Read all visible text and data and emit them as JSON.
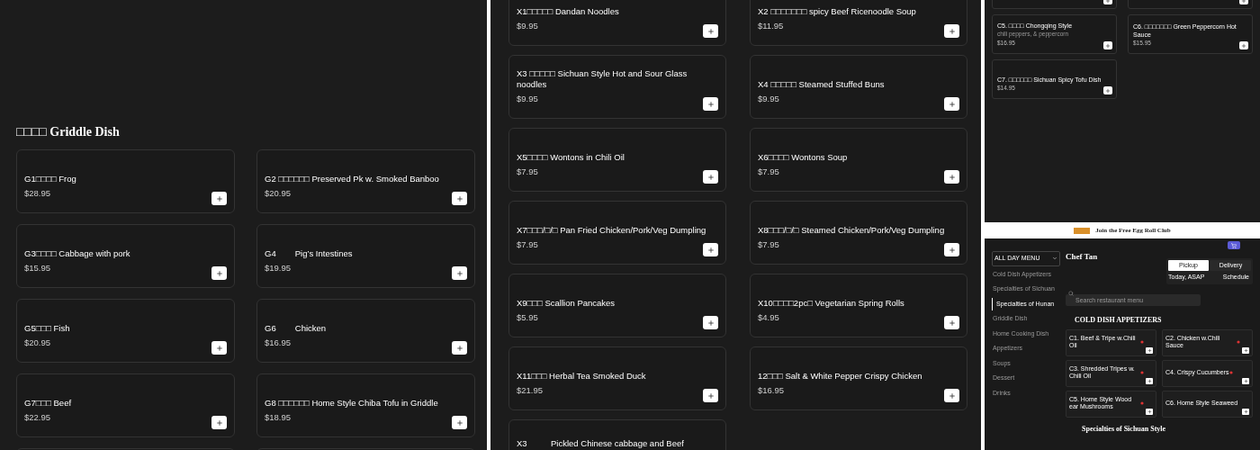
{
  "left_panel": {
    "section_title": "□□□□ Griddle Dish",
    "items": [
      {
        "name": "G1□□□□ Frog",
        "price": "$28.95"
      },
      {
        "name": "G2 □□□□□□ Preserved Pk w. Smoked Banboo",
        "price": "$20.95"
      },
      {
        "name": "G3□□□□ Cabbage with pork",
        "price": "$15.95"
      },
      {
        "name": "G4        Pig’s Intestines",
        "price": "$19.95"
      },
      {
        "name": "G5□□□ Fish",
        "price": "$20.95"
      },
      {
        "name": "G6        Chicken",
        "price": "$16.95"
      },
      {
        "name": "G7□□□ Beef",
        "price": "$22.95"
      },
      {
        "name": "G8 □□□□□□ Home Style Chiba Tofu in Griddle",
        "price": "$18.95"
      }
    ]
  },
  "middle_panel": {
    "items": [
      {
        "name": "X1□□□□□ Dandan Noodles",
        "price": "$9.95"
      },
      {
        "name": "X2 □□□□□□□ spicy Beef Ricenoodle Soup",
        "price": "$11.95"
      },
      {
        "name": "X3 □□□□□ Sichuan Style Hot and Sour Glass noodles",
        "price": "$9.95"
      },
      {
        "name": "X4 □□□□□ Steamed Stuffed Buns",
        "price": "$9.95"
      },
      {
        "name": "X5□□□□ Wontons in Chili Oil",
        "price": "$7.95"
      },
      {
        "name": "X6□□□□ Wontons Soup",
        "price": "$7.95"
      },
      {
        "name": "X7□□□/□/□ Pan Fried Chicken/Pork/Veg Dumpling",
        "price": "$7.95"
      },
      {
        "name": "X8□□□/□/□ Steamed Chicken/Pork/Veg Dumpling",
        "price": "$7.95"
      },
      {
        "name": "X9□□□ Scallion Pancakes",
        "price": "$5.95"
      },
      {
        "name": "X10□□□□2pc□ Vegetarian Spring Rolls",
        "price": "$4.95"
      },
      {
        "name": "X11□□□ Herbal Tea Smoked Duck",
        "price": "$21.95"
      },
      {
        "name": "12□□□ Salt & White Pepper Crispy Chicken",
        "price": "$16.95"
      },
      {
        "name": "X3          Pickled Chinese cabbage and Beef"
      }
    ]
  },
  "right_top_panel": {
    "items": [
      {
        "name": "C5. □□□□ Chongqing Style",
        "description": "chili peppers, & peppercorn",
        "price": "$16.95"
      },
      {
        "name": "C6. □□□□□□□ Green Peppercorn Hot Sauce",
        "price": "$15.95"
      },
      {
        "name": "C7. □□□□□□ Sichuan Spicy Tofu Dish",
        "price": "$14.95"
      }
    ]
  },
  "mini_page": {
    "top_bar": {
      "promo": "Join the Free Egg Roll Club"
    },
    "menu_select": {
      "value": "ALL DAY MENU"
    },
    "sidebar": [
      {
        "label": "Cold Dish Appetizers",
        "selected": false
      },
      {
        "label": "Specialties of Sichuan",
        "selected": false
      },
      {
        "label": "Specialties of Hunan",
        "selected": true
      },
      {
        "label": "Griddle Dish",
        "selected": false
      },
      {
        "label": "Home Cooking Dish",
        "selected": false
      },
      {
        "label": "Appetizers",
        "selected": false
      },
      {
        "label": "Soups",
        "selected": false
      },
      {
        "label": "Dessert",
        "selected": false
      },
      {
        "label": "Drinks",
        "selected": false
      }
    ],
    "restaurant": {
      "name": "Chef Tan"
    },
    "order_modes": [
      {
        "label": "Pickup",
        "selected": true
      },
      {
        "label": "Delivery",
        "selected": false
      }
    ],
    "time": {
      "value": "Today, ASAP",
      "button": "Schedule"
    },
    "search": {
      "placeholder": "Search restaurant menu"
    },
    "sections": [
      {
        "title": "COLD DISH APPETIZERS",
        "items": [
          {
            "name": "C1. Beef & Tripe w.Chili Oil",
            "spicy": true
          },
          {
            "name": "C2. Chicken w.Chili Sauce",
            "spicy": true
          },
          {
            "name": "C3. Shredded Tripes w. Chili Oil",
            "spicy": true
          },
          {
            "name": "C4. Crispy Cucumbers",
            "spicy": true
          },
          {
            "name": "C5. Home Style Wood ear Mushrooms",
            "spicy": true
          },
          {
            "name": "C6. Home Style Seaweed",
            "spicy": false
          }
        ]
      },
      {
        "title": "Specialties of Sichuan Style"
      }
    ]
  }
}
